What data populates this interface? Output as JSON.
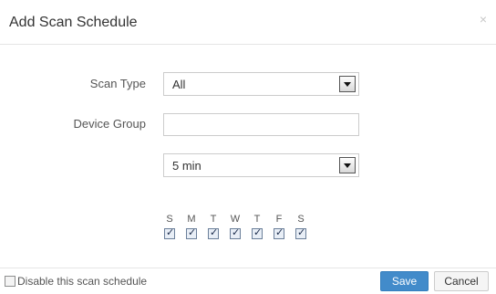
{
  "dialog": {
    "title": "Add Scan Schedule",
    "close_glyph": "×"
  },
  "form": {
    "scan_type_label": "Scan Type",
    "scan_type_value": "All",
    "device_group_label": "Device Group",
    "device_group_value": "",
    "interval_value": "5 min"
  },
  "days": [
    {
      "letter": "S",
      "checked": true
    },
    {
      "letter": "M",
      "checked": true
    },
    {
      "letter": "T",
      "checked": true
    },
    {
      "letter": "W",
      "checked": true
    },
    {
      "letter": "T",
      "checked": true
    },
    {
      "letter": "F",
      "checked": true
    },
    {
      "letter": "S",
      "checked": true
    }
  ],
  "footer": {
    "disable_label": "Disable this scan schedule",
    "disable_checked": false,
    "save_label": "Save",
    "cancel_label": "Cancel"
  },
  "colors": {
    "primary": "#428bca",
    "border": "#cccccc"
  }
}
